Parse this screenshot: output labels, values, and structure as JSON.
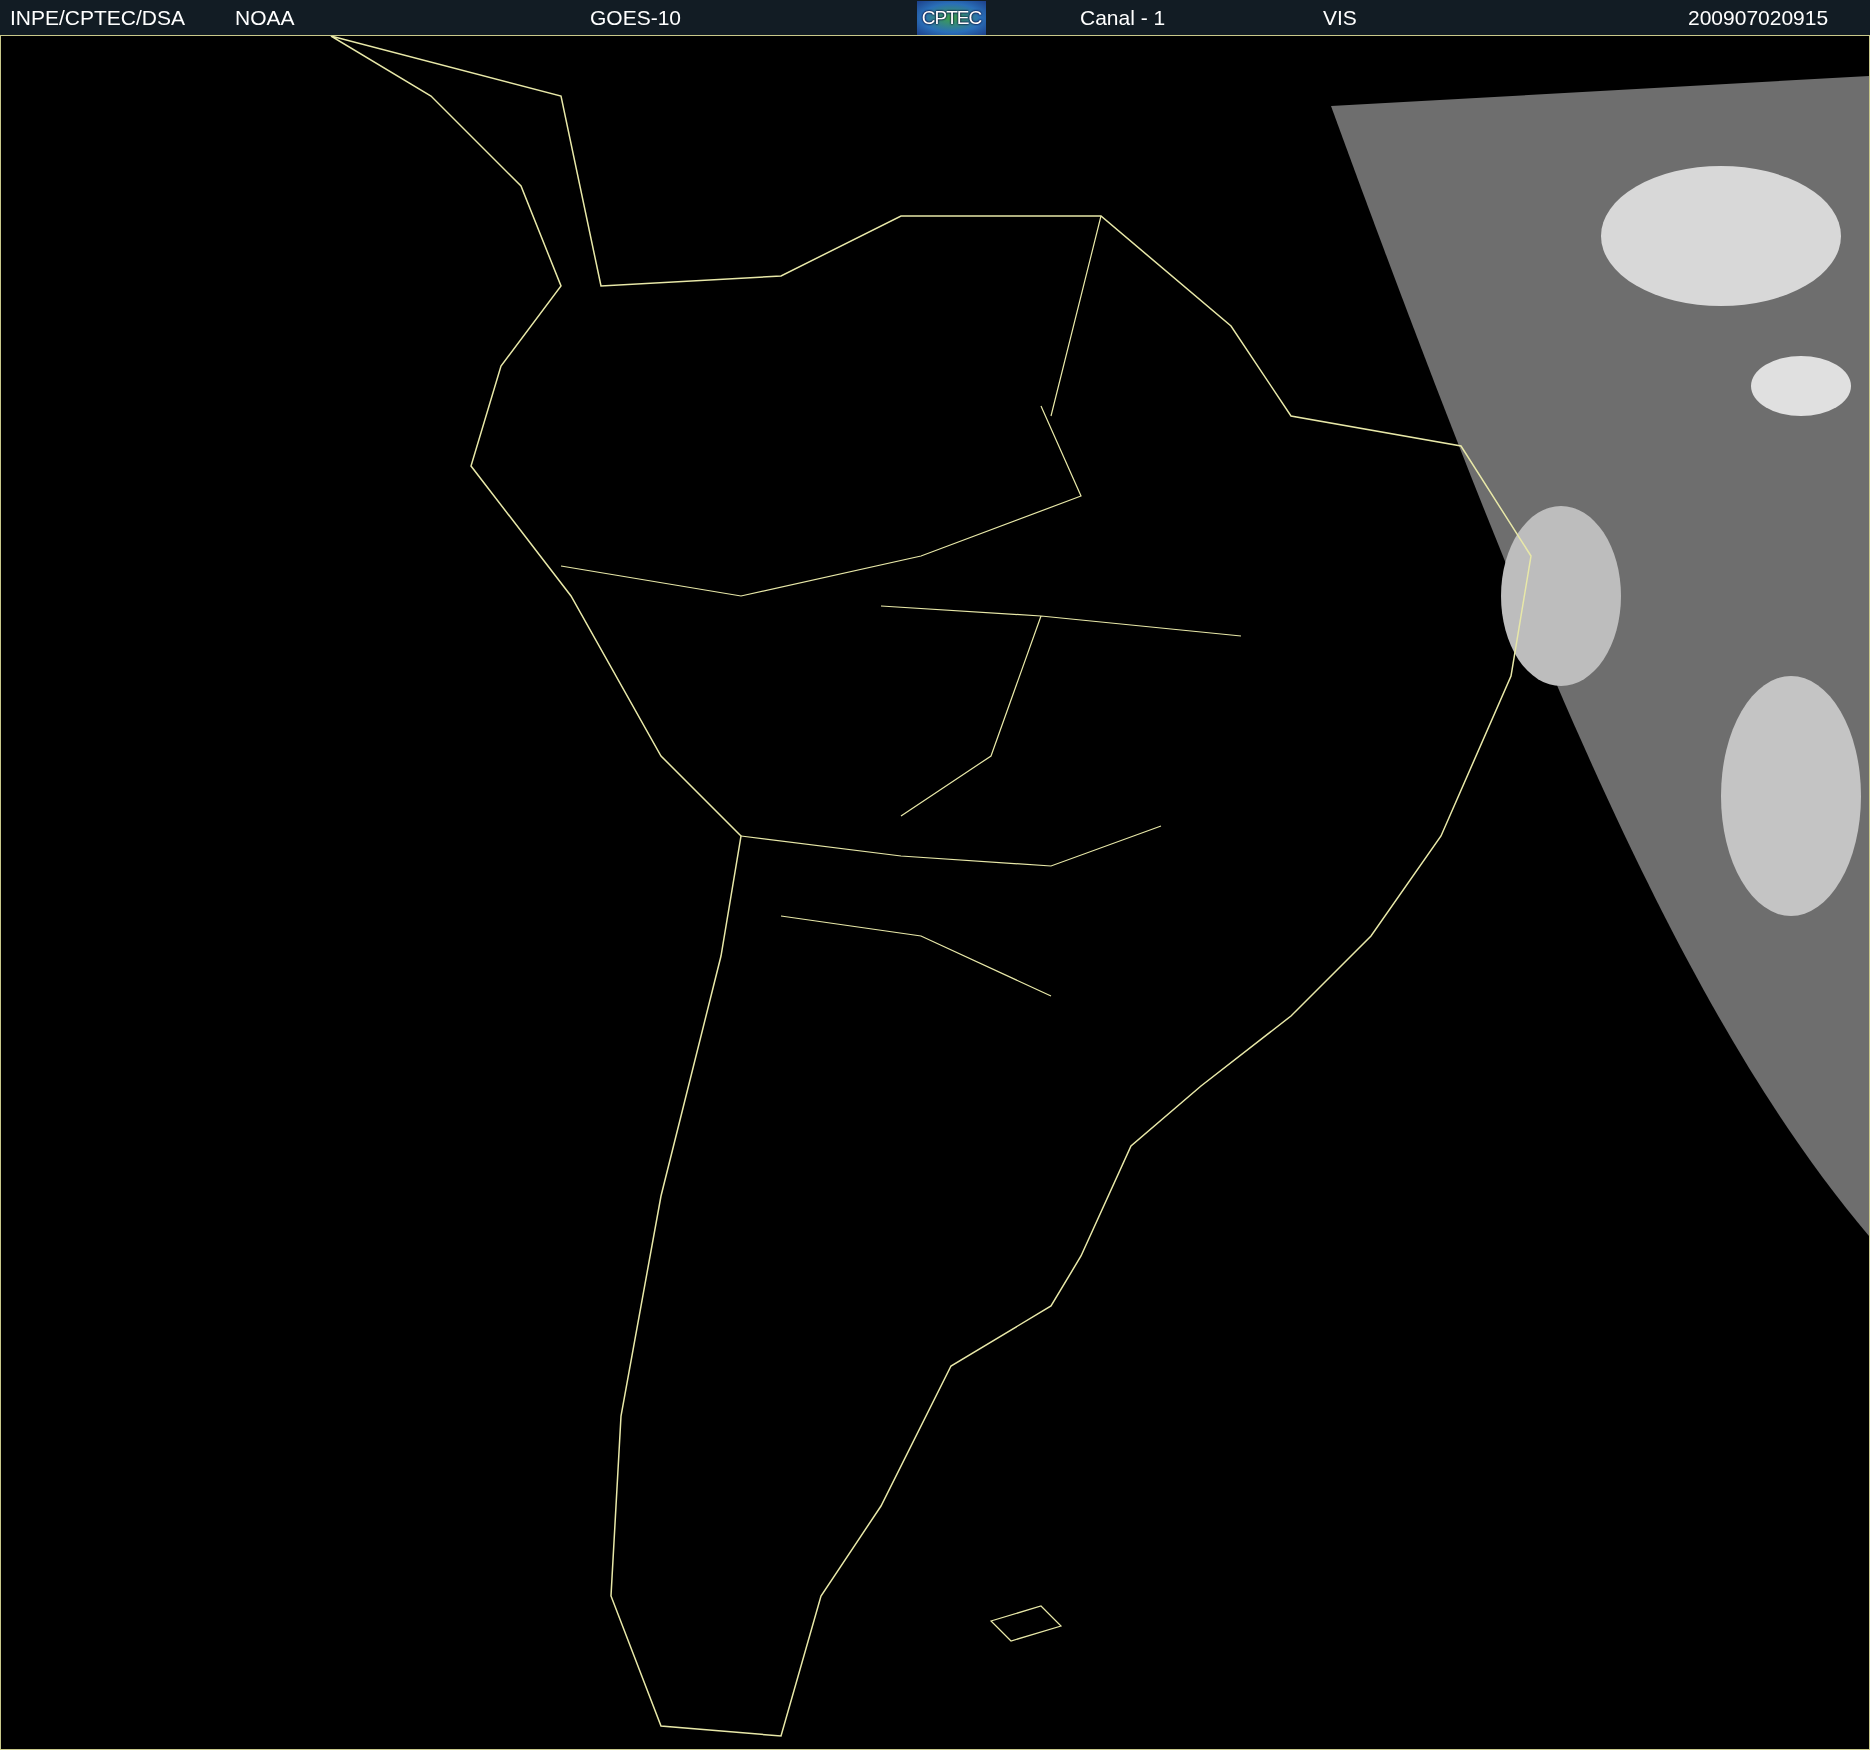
{
  "header": {
    "items": [
      {
        "kind": "text",
        "text": "INPE/CPTEC/DSA"
      },
      {
        "kind": "text",
        "text": "NOAA"
      },
      {
        "kind": "text",
        "text": "GOES-10"
      },
      {
        "kind": "logo",
        "text": "CPTEC"
      },
      {
        "kind": "text",
        "text": "Canal - 1"
      },
      {
        "kind": "text",
        "text": "VIS"
      },
      {
        "kind": "text",
        "text": "200907020915"
      }
    ]
  }
}
